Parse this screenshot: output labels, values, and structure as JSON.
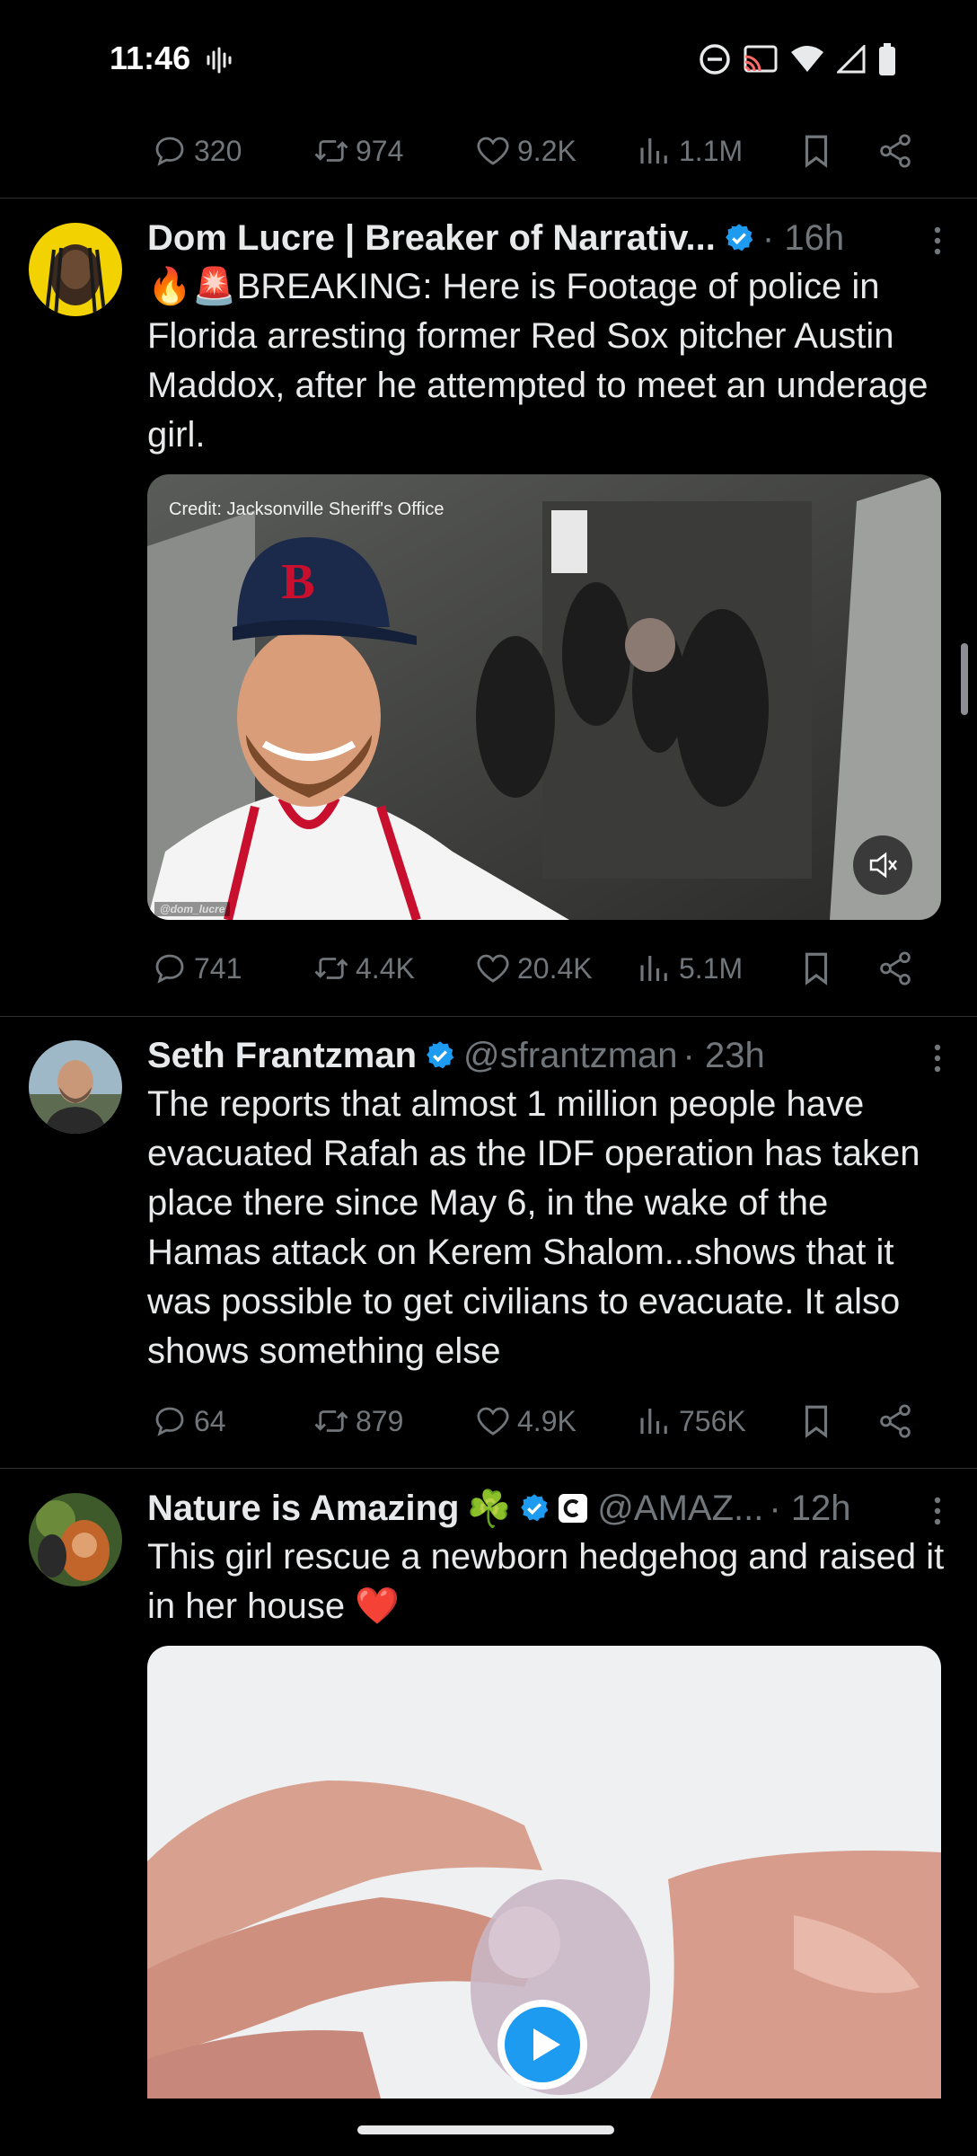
{
  "status_bar": {
    "time": "11:46"
  },
  "top_actions": {
    "replies": "320",
    "reposts": "974",
    "likes": "9.2K",
    "views": "1.1M"
  },
  "tweets": [
    {
      "name": "Dom Lucre | Breaker of Narrativ...",
      "handle": "",
      "time": "· 16h",
      "emoji_prefix": "🔥🚨",
      "text": "BREAKING: Here is Footage of police in Florida arresting former Red Sox pitcher Austin Maddox, after he attempted to meet an underage girl.",
      "media": {
        "credit": "Credit: Jacksonville Sheriff's Office",
        "watermark": "@dom_lucre"
      },
      "actions": {
        "replies": "741",
        "reposts": "4.4K",
        "likes": "20.4K",
        "views": "5.1M"
      }
    },
    {
      "name": "Seth Frantzman",
      "handle": "@sfrantzman",
      "time": "· 23h",
      "text": "The reports that almost 1 million people have evacuated Rafah as the IDF operation has taken place there since May 6, in the wake of the Hamas attack on Kerem Shalom...shows that it was possible to get civilians to evacuate. It also shows something else",
      "actions": {
        "replies": "64",
        "reposts": "879",
        "likes": "4.9K",
        "views": "756K"
      }
    },
    {
      "name": "Nature is Amazing",
      "name_emoji": "☘️",
      "handle": "@AMAZ...",
      "time": "· 12h",
      "text": "This girl rescue a newborn hedgehog and raised it in her house",
      "text_emoji": "❤️"
    }
  ],
  "colors": {
    "accent": "#1d9bf0",
    "muted": "#71767b",
    "background": "#000000"
  }
}
